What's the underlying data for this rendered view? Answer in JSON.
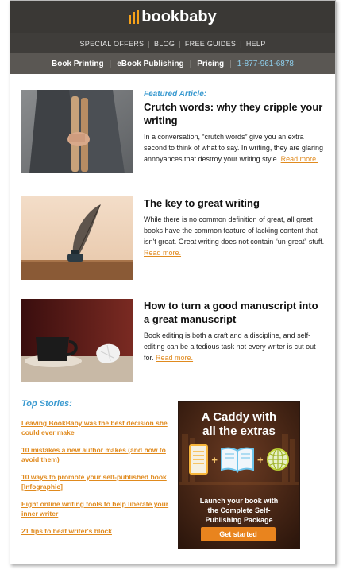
{
  "brand": {
    "name": "bookbaby"
  },
  "topnav": {
    "items": [
      "SPECIAL OFFERS",
      "BLOG",
      "FREE GUIDES",
      "HELP"
    ]
  },
  "mainnav": {
    "items": [
      "Book Printing",
      "eBook Publishing",
      "Pricing"
    ],
    "phone": "1-877-961-6878"
  },
  "articles": [
    {
      "featured_label": "Featured Article:",
      "title": "Crutch words: why they cripple your writing",
      "desc": "In a conversation, “crutch words” give you an extra second to think of what to say. In writing, they are glaring annoyances that destroy your writing style.",
      "read_more": "Read more."
    },
    {
      "featured_label": "",
      "title": "The key to great writing",
      "desc": "While there is no common definition of great, all great books have the common feature of lacking content that isn't great. Great writing does not contain “un-great” stuff.",
      "read_more": "Read more."
    },
    {
      "featured_label": "",
      "title": "How to turn a good manuscript into a great manuscript",
      "desc": "Book editing is both a craft and a discipline, and self-editing can be a tedious task not every writer is cut out for.",
      "read_more": "Read more."
    }
  ],
  "top_stories": {
    "heading": "Top Stories:",
    "items": [
      "Leaving BookBaby was the best decision she could ever make",
      "10 mistakes a new author makes (and how to avoid them)",
      "10 ways to promote your self-published book [Infographic]",
      "Eight online writing tools to help liberate your inner writer",
      "21 tips to beat writer's block"
    ]
  },
  "ad": {
    "title_line1": "A Caddy with",
    "title_line2": "all the extras",
    "body_line1": "Launch your book with",
    "body_line2": "the Complete Self-",
    "body_line3": "Publishing Package",
    "button": "Get started"
  },
  "colors": {
    "accent_blue": "#3a9ad0",
    "link_orange": "#e08a1e",
    "header_dark": "#3a3835",
    "button_orange": "#e9841e"
  }
}
